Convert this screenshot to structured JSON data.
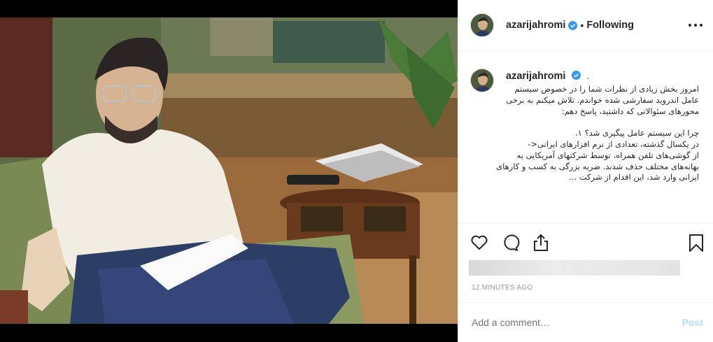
{
  "header": {
    "username": "azarijahromi",
    "separator": "•",
    "follow_status": "Following",
    "verified_icon": "verified-badge-icon",
    "more_icon": "more-options-icon"
  },
  "caption": {
    "username": "azarijahromi",
    "trailing": ".",
    "text": "امروز بخش زیادی از نظرات شما را در خصوص سیستم عامل اندروید سفارشی شده خواندم. تلاش میکنم به برخی محورهای سئوالاتی که داشتید، پاسخ دهم:\n\nچرا این سیستم عامل پیگیری شد؟ ۱.\nدر یکسال گذشته، تعدادی از نرم افزارهای ایرانی<-\nاز گوشی‌های تلفن همراه، توسط شرکتهای آمریکایی به بهانه‌های مختلف حذف شدند. ضربه بزرگی به کسب و کارهای ایرانی وارد شد، این اقدام از شرکت ..."
  },
  "actions": {
    "like_icon": "heart-icon",
    "comment_icon": "comment-icon",
    "share_icon": "share-icon",
    "save_icon": "bookmark-icon"
  },
  "timestamp": "12 MINUTES AGO",
  "add_comment": {
    "placeholder": "Add a comment…",
    "post_label": "Post"
  },
  "colors": {
    "verified": "#3897f0",
    "post_disabled": "#b2dffc",
    "text": "#262626",
    "muted": "#999999"
  }
}
